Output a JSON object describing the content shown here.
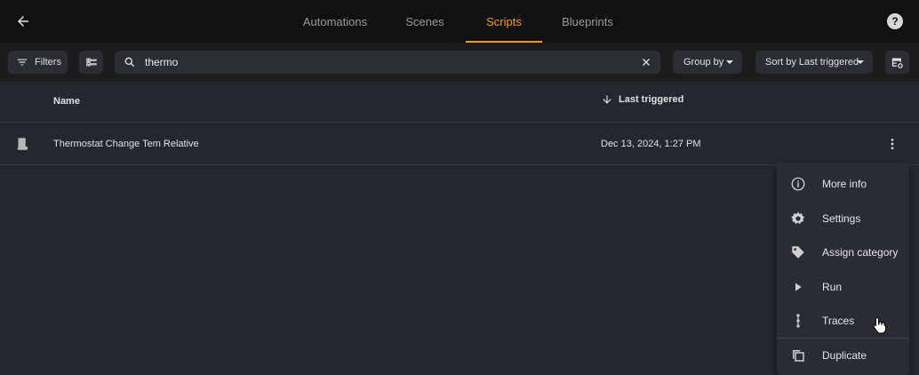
{
  "nav": {
    "tabs": [
      {
        "label": "Automations"
      },
      {
        "label": "Scenes"
      },
      {
        "label": "Scripts"
      },
      {
        "label": "Blueprints"
      }
    ],
    "active_tab": "Scripts",
    "accent": "#ff9800"
  },
  "toolbar": {
    "filters_label": "Filters",
    "search_value": "thermo",
    "group_by_label": "Group by",
    "sort_label": "Sort by Last triggered"
  },
  "table": {
    "columns": {
      "name": "Name",
      "last_triggered": "Last triggered"
    },
    "rows": [
      {
        "name": "Thermostat Change Tem Relative",
        "last_triggered": "Dec 13, 2024, 1:27 PM"
      }
    ]
  },
  "menu": {
    "items": [
      {
        "label": "More info",
        "icon": "info-icon"
      },
      {
        "label": "Settings",
        "icon": "gear-icon"
      },
      {
        "label": "Assign category",
        "icon": "tag-icon"
      },
      {
        "label": "Run",
        "icon": "play-icon"
      },
      {
        "label": "Traces",
        "icon": "traces-icon"
      },
      {
        "label": "Duplicate",
        "icon": "duplicate-icon"
      }
    ]
  }
}
